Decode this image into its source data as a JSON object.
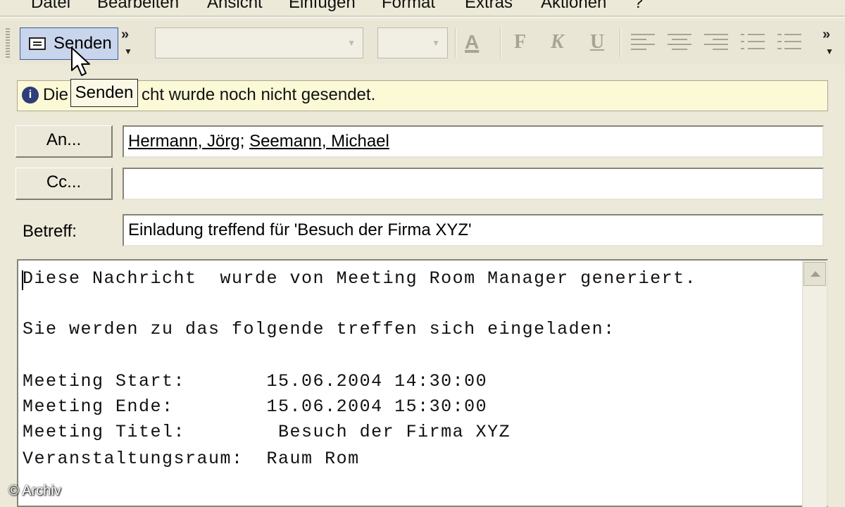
{
  "menu": [
    "Datei",
    "Bearbeiten",
    "Ansicht",
    "Einfügen",
    "Format",
    "Extras",
    "Aktionen",
    "?"
  ],
  "toolbar": {
    "send_label": "Senden",
    "overflow_label": "»",
    "bold_label": "F",
    "italic_label": "K",
    "underline_label": "U",
    "font_color_label": "A"
  },
  "infobar": {
    "text": "Diese Nachricht wurde noch nicht gesendet.",
    "text_prefix": "Die",
    "text_suffix": "cht wurde noch nicht gesendet."
  },
  "tooltip": "Senden",
  "to": {
    "button_label": "An...",
    "recipients": [
      "Hermann, Jörg",
      "Seemann, Michael"
    ],
    "separator": "; "
  },
  "cc": {
    "button_label": "Cc...",
    "value": ""
  },
  "subject": {
    "label": "Betreff:",
    "value": "Einladung treffend für 'Besuch der Firma XYZ'"
  },
  "body": {
    "lines": [
      "Diese Nachricht  wurde von Meeting Room Manager generiert.",
      "",
      "Sie werden zu das folgende treffen sich eingeladen:",
      "",
      "Meeting Start:       15.06.2004 14:30:00",
      "Meeting Ende:        15.06.2004 15:30:00",
      "Meeting Titel:        Besuch der Firma XYZ",
      "Veranstaltungsraum:  Raum Rom"
    ]
  },
  "watermark": "© Archiv",
  "icons": {
    "send": "send-mail-icon",
    "info": "info-icon",
    "cursor": "mouse-pointer-icon",
    "scroll_up": "scroll-up-arrow-icon"
  },
  "colors": {
    "window_bg": "#ece9d8",
    "send_highlight": "#c8d5ec",
    "infobar_bg": "#fbf9d6",
    "info_icon": "#2d3e78"
  }
}
